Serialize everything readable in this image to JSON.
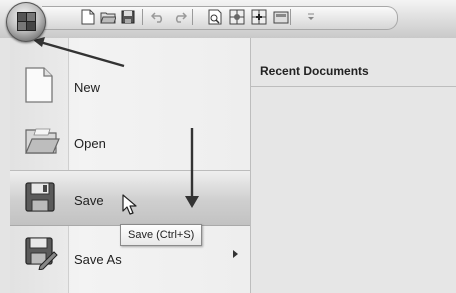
{
  "menu": {
    "items": [
      {
        "label": "New",
        "icon": "new-document-icon"
      },
      {
        "label": "Open",
        "icon": "open-folder-icon"
      },
      {
        "label": "Save",
        "icon": "save-floppy-icon"
      },
      {
        "label": "Save As",
        "icon": "save-as-icon"
      }
    ]
  },
  "recent": {
    "header": "Recent Documents"
  },
  "tooltip": {
    "text": "Save (Ctrl+S)"
  },
  "colors": {
    "highlight": "#c8c8c8",
    "pane": "#e6e6e6",
    "arrow": "#333333"
  }
}
